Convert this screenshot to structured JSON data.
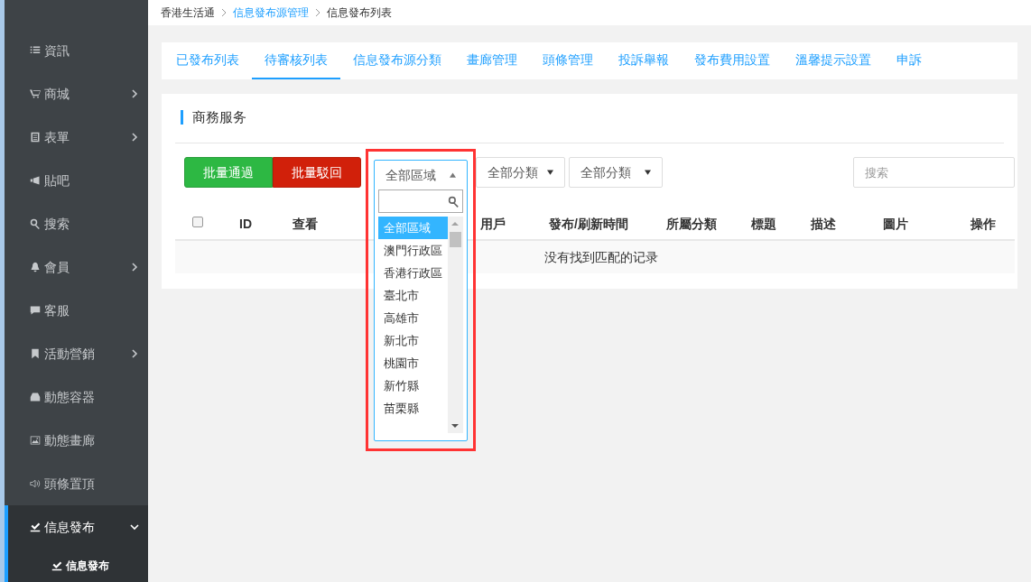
{
  "sidebar": {
    "items": [
      {
        "label": "資訊",
        "has_submenu": false,
        "selected": false
      },
      {
        "label": "商城",
        "has_submenu": true,
        "expanded": false,
        "selected": false
      },
      {
        "label": "表單",
        "has_submenu": true,
        "expanded": false,
        "selected": false
      },
      {
        "label": "貼吧",
        "has_submenu": false,
        "selected": false
      },
      {
        "label": "搜索",
        "has_submenu": false,
        "selected": false
      },
      {
        "label": "會員",
        "has_submenu": true,
        "expanded": false,
        "selected": false
      },
      {
        "label": "客服",
        "has_submenu": false,
        "selected": false
      },
      {
        "label": "活動營銷",
        "has_submenu": true,
        "expanded": false,
        "selected": false
      },
      {
        "label": "動態容器",
        "has_submenu": false,
        "selected": false
      },
      {
        "label": "動態畫廊",
        "has_submenu": false,
        "selected": false
      },
      {
        "label": "頭條置頂",
        "has_submenu": false,
        "selected": false
      },
      {
        "label": "信息發布",
        "has_submenu": true,
        "expanded": true,
        "selected": true,
        "children": [
          {
            "label": "信息發布"
          }
        ]
      }
    ]
  },
  "breadcrumb": [
    {
      "label": "香港生活通",
      "link": false
    },
    {
      "label": "信息發布源管理",
      "link": true
    },
    {
      "label": "信息發布列表",
      "link": false
    }
  ],
  "tabs": [
    {
      "label": "已發布列表",
      "selected": false
    },
    {
      "label": "待審核列表",
      "selected": true
    },
    {
      "label": "信息發布源分類",
      "selected": false
    },
    {
      "label": "畫廊管理",
      "selected": false
    },
    {
      "label": "頭條管理",
      "selected": false
    },
    {
      "label": "投訴舉報",
      "selected": false
    },
    {
      "label": "發布費用設置",
      "selected": false
    },
    {
      "label": "溫馨提示設置",
      "selected": false
    },
    {
      "label": "申訴",
      "selected": false
    }
  ],
  "panel": {
    "title": "商務服务",
    "buttons": [
      {
        "label": "批量通過",
        "kind": "approve"
      },
      {
        "label": "批量駁回",
        "kind": "reject"
      }
    ],
    "region_select": {
      "value": "全部區域",
      "expanded": true,
      "options": [
        {
          "label": "全部區域",
          "selected": true
        },
        {
          "label": "澳門行政區",
          "selected": false
        },
        {
          "label": "香港行政區",
          "selected": false
        },
        {
          "label": "臺北市",
          "selected": false
        },
        {
          "label": "高雄市",
          "selected": false
        },
        {
          "label": "新北市",
          "selected": false
        },
        {
          "label": "桃園市",
          "selected": false
        },
        {
          "label": "新竹縣",
          "selected": false
        },
        {
          "label": "苗栗縣",
          "selected": false
        }
      ]
    },
    "category_selects": [
      {
        "value": "全部分類"
      },
      {
        "value": "全部分類"
      }
    ],
    "search": {
      "placeholder": "搜索"
    },
    "table": {
      "select_all_checked": false,
      "columns": [
        "ID",
        "查看",
        "用戶",
        "發布/刷新時間",
        "所屬分類",
        "標題",
        "描述",
        "圖片",
        "操作"
      ],
      "empty_message": "没有找到匹配的记录"
    }
  }
}
